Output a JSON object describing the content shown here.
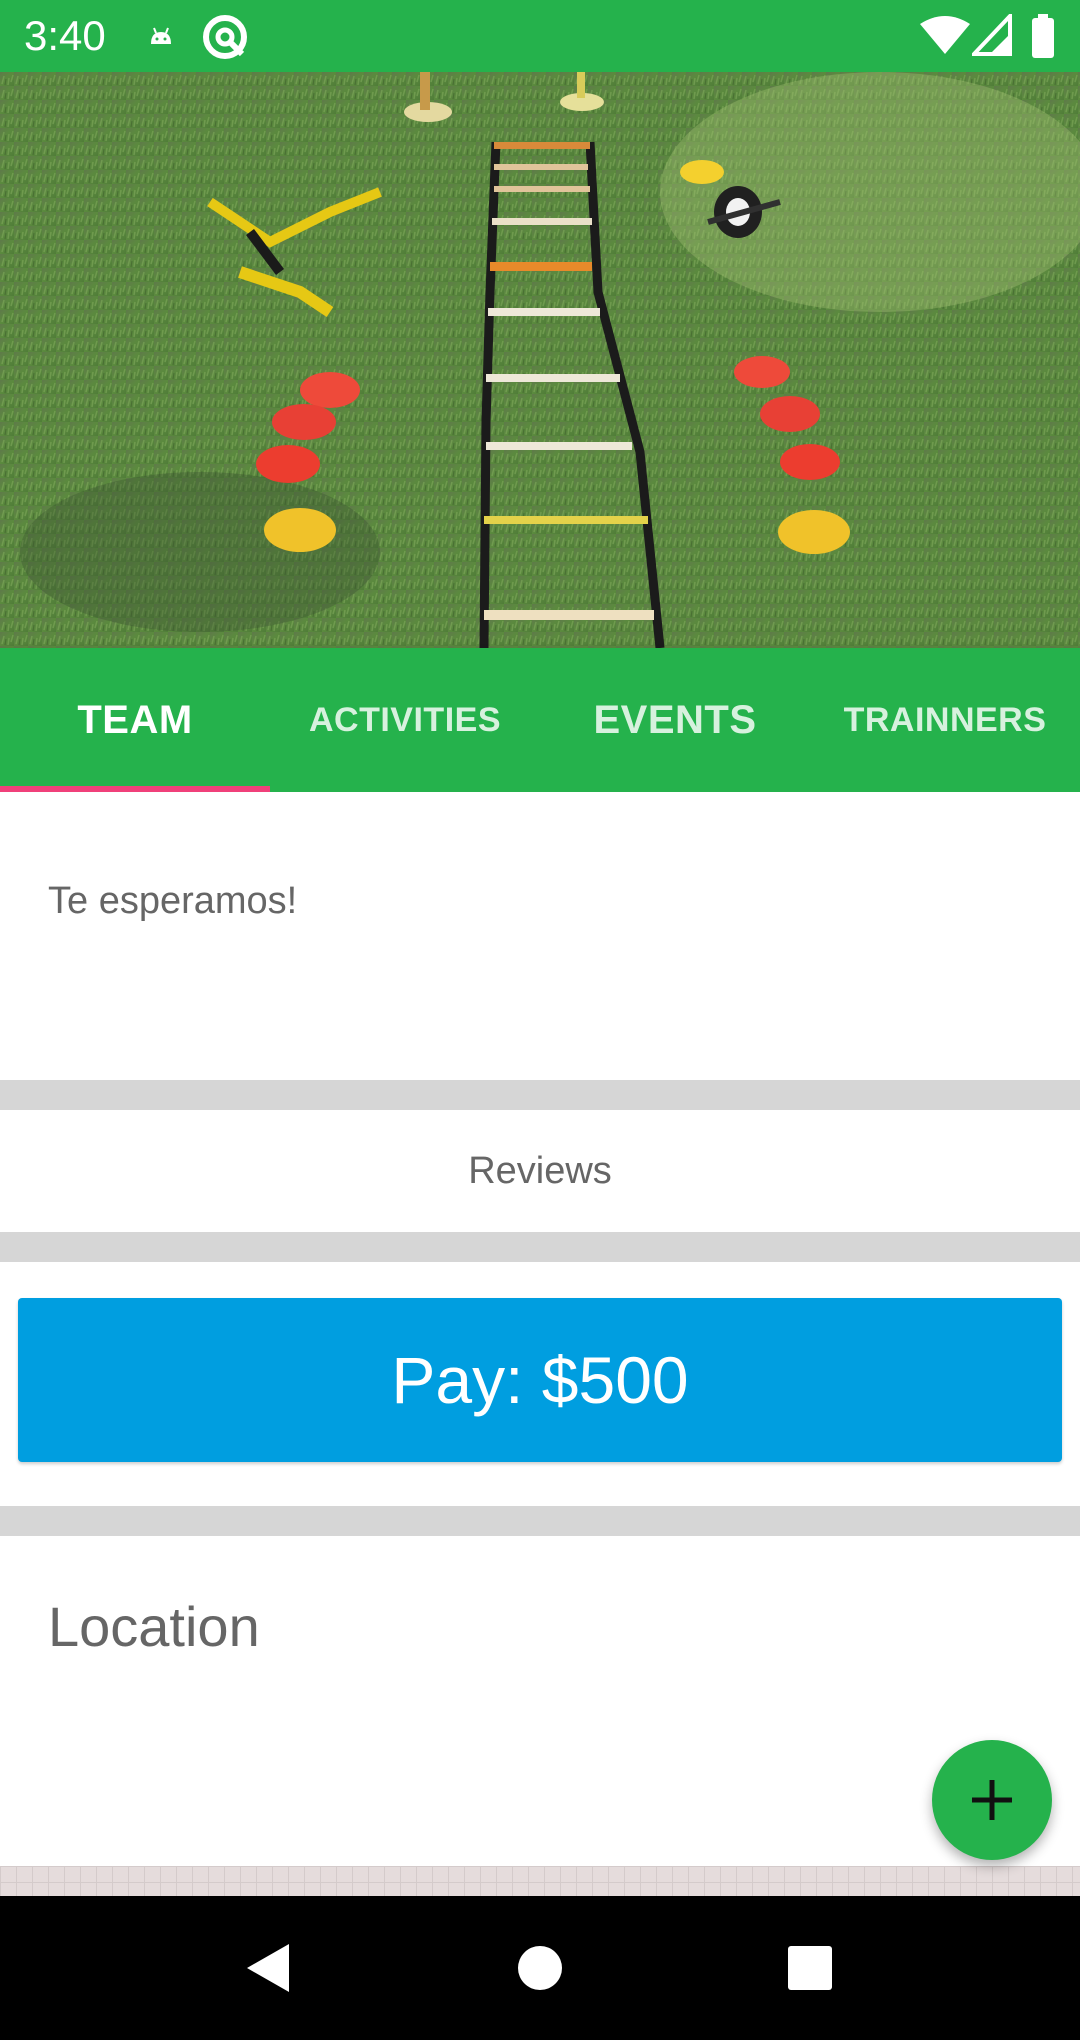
{
  "status_bar": {
    "time": "3:40",
    "icons": [
      "android-icon",
      "q-badge-icon",
      "wifi-icon",
      "signal-icon",
      "battery-icon"
    ]
  },
  "hero": {
    "icon": "fitness-equipment-photo"
  },
  "tabs": [
    {
      "label": "TEAM",
      "active": true
    },
    {
      "label": "ACTIVITIES",
      "active": false
    },
    {
      "label": "EVENTS",
      "active": false
    },
    {
      "label": "TRAINNERS",
      "active": false
    }
  ],
  "description": "Te esperamos!",
  "reviews_label": "Reviews",
  "pay_label": "Pay: $500",
  "location_title": "Location",
  "fab": {
    "icon": "plus-icon"
  },
  "nav": {
    "icons": [
      "back-icon",
      "home-icon",
      "recents-icon"
    ]
  },
  "colors": {
    "primary": "#25b24c",
    "accent": "#f0407a",
    "pay_button": "#009ee0",
    "divider": "#d6d6d6"
  }
}
